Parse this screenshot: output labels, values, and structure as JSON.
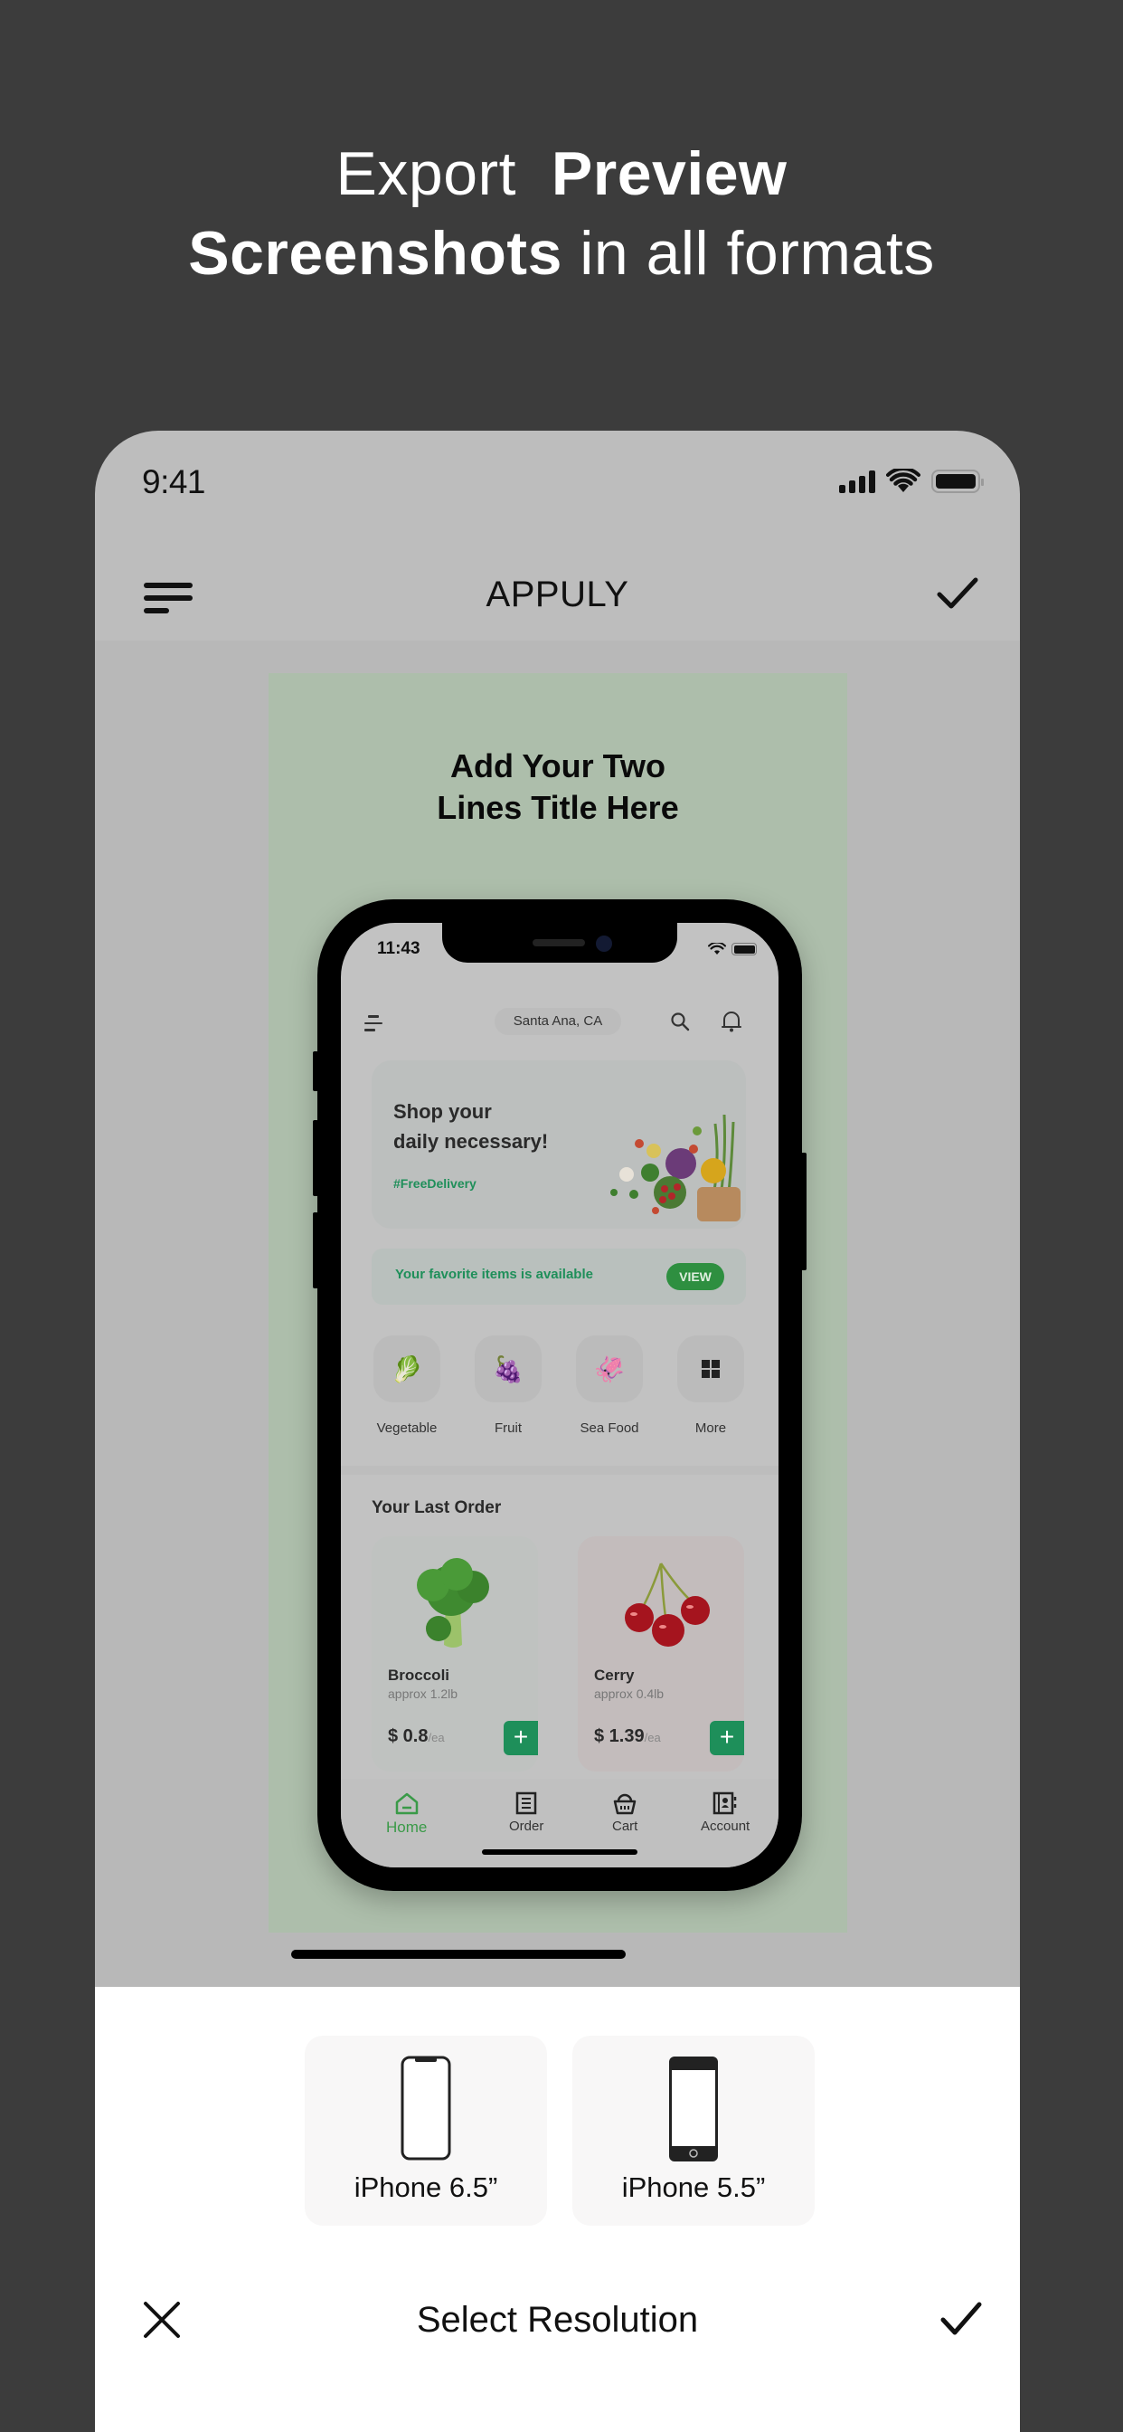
{
  "headline": {
    "line1_regular": "Export",
    "line1_bold": "Preview",
    "line2_bold": "Screenshots",
    "line2_regular": "in all formats"
  },
  "status_bar": {
    "time": "9:41"
  },
  "navbar": {
    "title": "APPULY",
    "menu_icon": "menu-icon",
    "confirm_icon": "checkmark-icon"
  },
  "poster": {
    "title_line1": "Add Your Two",
    "title_line2": "Lines Title Here",
    "background_color": "#adbeab"
  },
  "app_mock": {
    "status_time": "11:43",
    "location": "Santa Ana, CA",
    "banner": {
      "line1": "Shop your",
      "line2": "daily necessary!",
      "tag": "#FreeDelivery"
    },
    "favorite": {
      "text": "Your favorite items is available",
      "button": "VIEW"
    },
    "categories": [
      {
        "label": "Vegetable",
        "icon": "🥬"
      },
      {
        "label": "Fruit",
        "icon": "🍇"
      },
      {
        "label": "Sea Food",
        "icon": "🦑"
      },
      {
        "label": "More",
        "icon": "grid-icon"
      }
    ],
    "last_order_title": "Your Last Order",
    "orders": [
      {
        "name": "Broccoli",
        "approx": "approx 1.2lb",
        "price": "$ 0.8",
        "unit": "/ea"
      },
      {
        "name": "Cerry",
        "approx": "approx 0.4lb",
        "price": "$ 1.39",
        "unit": "/ea"
      }
    ],
    "tabs": [
      {
        "label": "Home",
        "active": true
      },
      {
        "label": "Order",
        "active": false
      },
      {
        "label": "Cart",
        "active": false
      },
      {
        "label": "Account",
        "active": false
      }
    ],
    "accent_color": "#1f8f5a"
  },
  "sheet": {
    "options": [
      {
        "label": "iPhone 6.5”",
        "device": "iphone-notch-icon"
      },
      {
        "label": "iPhone 5.5”",
        "device": "iphone-home-button-icon"
      }
    ],
    "title": "Select Resolution"
  }
}
